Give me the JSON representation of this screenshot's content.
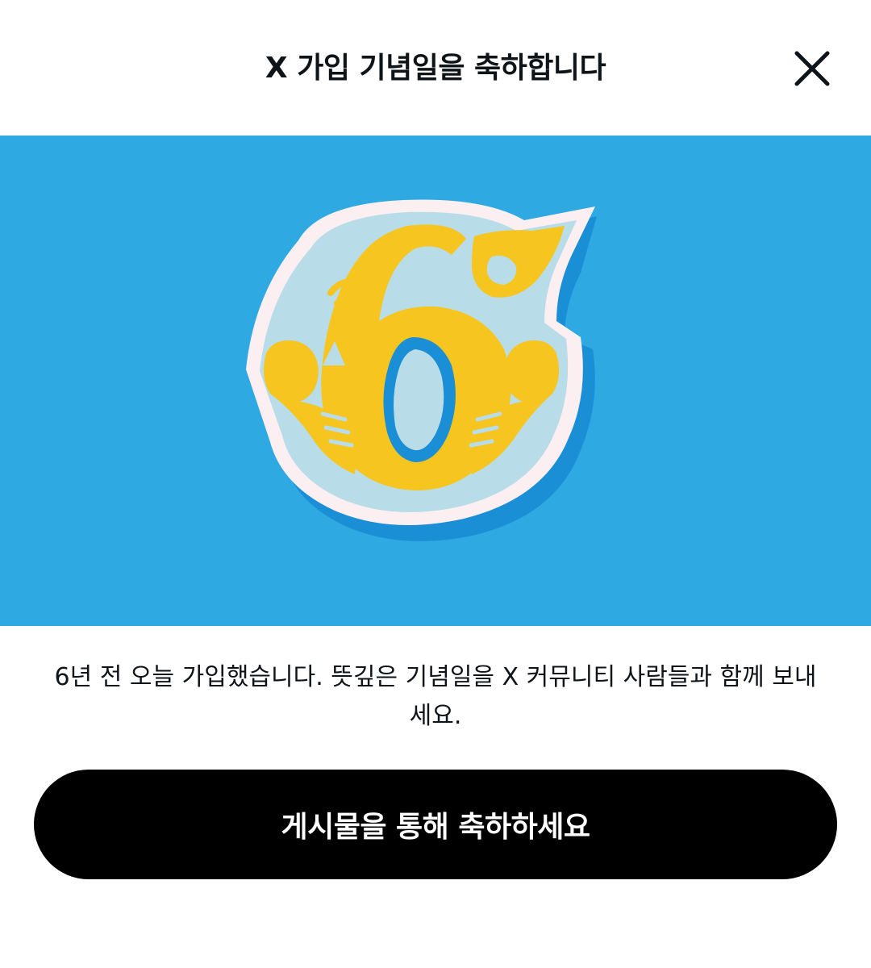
{
  "dialog": {
    "title": "X 가입 기념일을 축하합니다",
    "close_icon": "close-icon"
  },
  "hero": {
    "badge_number": "6",
    "background_color": "#2ea9e2",
    "accent_color": "#f6c51f"
  },
  "message": {
    "body": "6년 전 오늘 가입했습니다. 뜻깊은 기념일을 X 커뮤니티 사람들과 함께 보내세요."
  },
  "cta": {
    "label": "게시물을 통해 축하하세요"
  }
}
